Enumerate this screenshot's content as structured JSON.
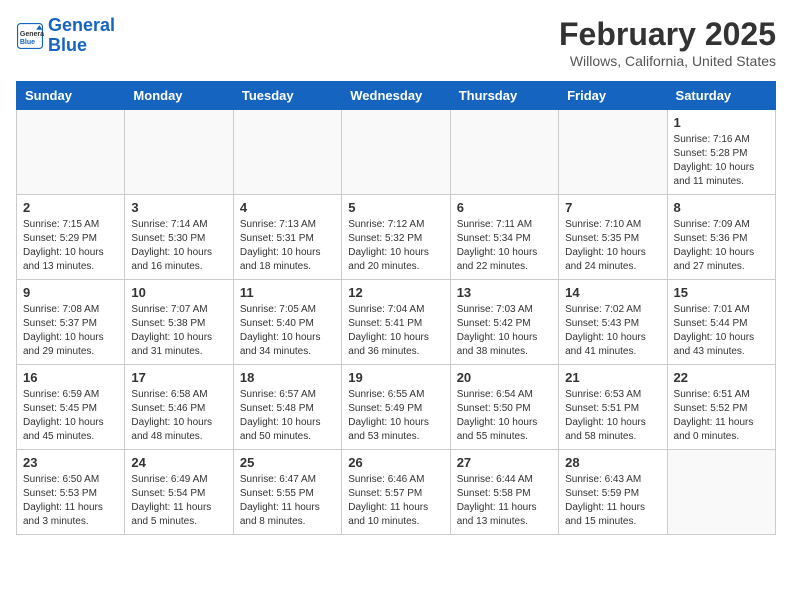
{
  "header": {
    "logo_line1": "General",
    "logo_line2": "Blue",
    "title": "February 2025",
    "subtitle": "Willows, California, United States"
  },
  "weekdays": [
    "Sunday",
    "Monday",
    "Tuesday",
    "Wednesday",
    "Thursday",
    "Friday",
    "Saturday"
  ],
  "weeks": [
    [
      {
        "day": "",
        "info": ""
      },
      {
        "day": "",
        "info": ""
      },
      {
        "day": "",
        "info": ""
      },
      {
        "day": "",
        "info": ""
      },
      {
        "day": "",
        "info": ""
      },
      {
        "day": "",
        "info": ""
      },
      {
        "day": "1",
        "info": "Sunrise: 7:16 AM\nSunset: 5:28 PM\nDaylight: 10 hours\nand 11 minutes."
      }
    ],
    [
      {
        "day": "2",
        "info": "Sunrise: 7:15 AM\nSunset: 5:29 PM\nDaylight: 10 hours\nand 13 minutes."
      },
      {
        "day": "3",
        "info": "Sunrise: 7:14 AM\nSunset: 5:30 PM\nDaylight: 10 hours\nand 16 minutes."
      },
      {
        "day": "4",
        "info": "Sunrise: 7:13 AM\nSunset: 5:31 PM\nDaylight: 10 hours\nand 18 minutes."
      },
      {
        "day": "5",
        "info": "Sunrise: 7:12 AM\nSunset: 5:32 PM\nDaylight: 10 hours\nand 20 minutes."
      },
      {
        "day": "6",
        "info": "Sunrise: 7:11 AM\nSunset: 5:34 PM\nDaylight: 10 hours\nand 22 minutes."
      },
      {
        "day": "7",
        "info": "Sunrise: 7:10 AM\nSunset: 5:35 PM\nDaylight: 10 hours\nand 24 minutes."
      },
      {
        "day": "8",
        "info": "Sunrise: 7:09 AM\nSunset: 5:36 PM\nDaylight: 10 hours\nand 27 minutes."
      }
    ],
    [
      {
        "day": "9",
        "info": "Sunrise: 7:08 AM\nSunset: 5:37 PM\nDaylight: 10 hours\nand 29 minutes."
      },
      {
        "day": "10",
        "info": "Sunrise: 7:07 AM\nSunset: 5:38 PM\nDaylight: 10 hours\nand 31 minutes."
      },
      {
        "day": "11",
        "info": "Sunrise: 7:05 AM\nSunset: 5:40 PM\nDaylight: 10 hours\nand 34 minutes."
      },
      {
        "day": "12",
        "info": "Sunrise: 7:04 AM\nSunset: 5:41 PM\nDaylight: 10 hours\nand 36 minutes."
      },
      {
        "day": "13",
        "info": "Sunrise: 7:03 AM\nSunset: 5:42 PM\nDaylight: 10 hours\nand 38 minutes."
      },
      {
        "day": "14",
        "info": "Sunrise: 7:02 AM\nSunset: 5:43 PM\nDaylight: 10 hours\nand 41 minutes."
      },
      {
        "day": "15",
        "info": "Sunrise: 7:01 AM\nSunset: 5:44 PM\nDaylight: 10 hours\nand 43 minutes."
      }
    ],
    [
      {
        "day": "16",
        "info": "Sunrise: 6:59 AM\nSunset: 5:45 PM\nDaylight: 10 hours\nand 45 minutes."
      },
      {
        "day": "17",
        "info": "Sunrise: 6:58 AM\nSunset: 5:46 PM\nDaylight: 10 hours\nand 48 minutes."
      },
      {
        "day": "18",
        "info": "Sunrise: 6:57 AM\nSunset: 5:48 PM\nDaylight: 10 hours\nand 50 minutes."
      },
      {
        "day": "19",
        "info": "Sunrise: 6:55 AM\nSunset: 5:49 PM\nDaylight: 10 hours\nand 53 minutes."
      },
      {
        "day": "20",
        "info": "Sunrise: 6:54 AM\nSunset: 5:50 PM\nDaylight: 10 hours\nand 55 minutes."
      },
      {
        "day": "21",
        "info": "Sunrise: 6:53 AM\nSunset: 5:51 PM\nDaylight: 10 hours\nand 58 minutes."
      },
      {
        "day": "22",
        "info": "Sunrise: 6:51 AM\nSunset: 5:52 PM\nDaylight: 11 hours\nand 0 minutes."
      }
    ],
    [
      {
        "day": "23",
        "info": "Sunrise: 6:50 AM\nSunset: 5:53 PM\nDaylight: 11 hours\nand 3 minutes."
      },
      {
        "day": "24",
        "info": "Sunrise: 6:49 AM\nSunset: 5:54 PM\nDaylight: 11 hours\nand 5 minutes."
      },
      {
        "day": "25",
        "info": "Sunrise: 6:47 AM\nSunset: 5:55 PM\nDaylight: 11 hours\nand 8 minutes."
      },
      {
        "day": "26",
        "info": "Sunrise: 6:46 AM\nSunset: 5:57 PM\nDaylight: 11 hours\nand 10 minutes."
      },
      {
        "day": "27",
        "info": "Sunrise: 6:44 AM\nSunset: 5:58 PM\nDaylight: 11 hours\nand 13 minutes."
      },
      {
        "day": "28",
        "info": "Sunrise: 6:43 AM\nSunset: 5:59 PM\nDaylight: 11 hours\nand 15 minutes."
      },
      {
        "day": "",
        "info": ""
      }
    ]
  ]
}
